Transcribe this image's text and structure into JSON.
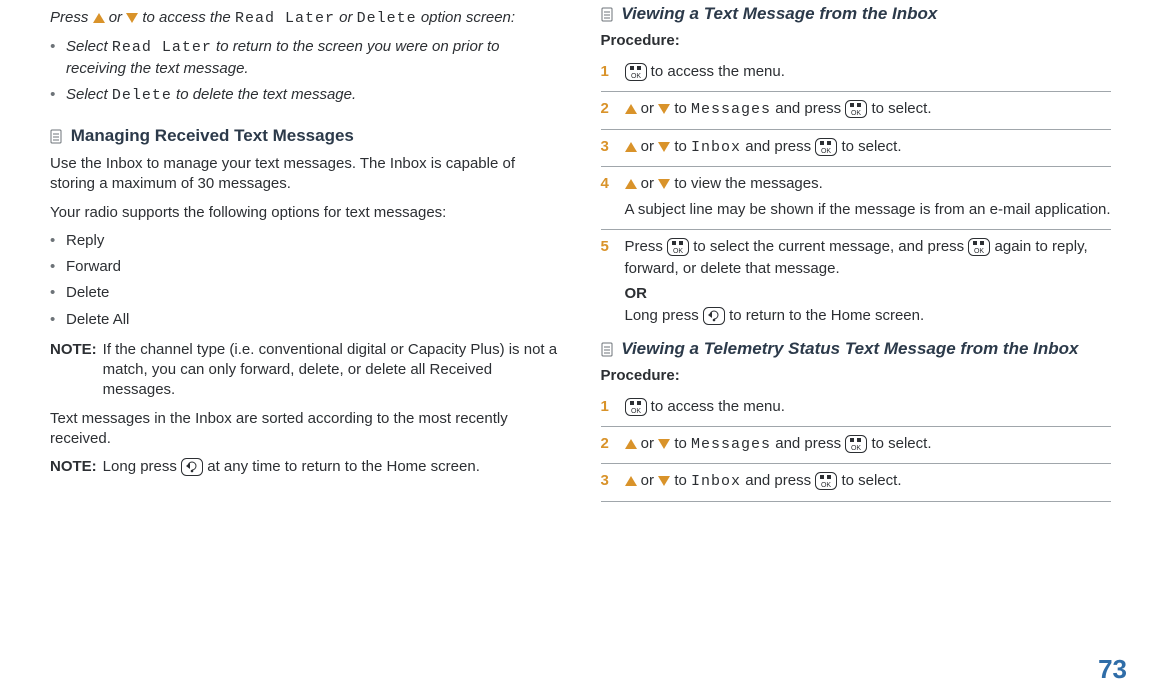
{
  "left": {
    "intro_pre": "Press ",
    "intro_mid": " or ",
    "intro_after_arrows": " to access the ",
    "intro_code1": "Read Later",
    "intro_between_codes": " or ",
    "intro_code2": "Delete",
    "intro_end": " option screen:",
    "bullet1_pre": "Select ",
    "bullet1_code": "Read Later",
    "bullet1_post": " to return to the screen you were on prior to receiving the text message.",
    "bullet2_pre": "Select ",
    "bullet2_code": "Delete",
    "bullet2_post": " to delete the text message.",
    "section_title": "Managing Received Text Messages",
    "para1": "Use the Inbox to manage your text messages. The Inbox is capable of storing a maximum of 30 messages.",
    "para2": "Your radio supports the following options for text messages:",
    "options": [
      "Reply",
      "Forward",
      "Delete",
      "Delete All"
    ],
    "note1_label": "NOTE:",
    "note1_body": "If the channel type (i.e. conventional digital or Capacity Plus) is not a match, you can only forward, delete, or delete all Received messages.",
    "para3": "Text messages in the Inbox are sorted according to the most recently received.",
    "note2_label": "NOTE:",
    "note2_pre": "Long press ",
    "note2_post": " at any time to return to the Home screen."
  },
  "right": {
    "sub1_title": "Viewing a Text Message from the Inbox",
    "procedure_label": "Procedure:",
    "step1_post": " to access the menu.",
    "step2_or": " or ",
    "step2_to": " to ",
    "step2_code": "Messages",
    "step2_press": " and press ",
    "step2_end": " to select.",
    "step3_code": "Inbox",
    "step4_post": " to view the messages.",
    "step4_second": "A subject line may be shown if the message is from an e-mail application.",
    "step5_pre": "Press ",
    "step5_mid": " to select the current message, and press ",
    "step5_end": " again to reply, forward, or delete that message.",
    "or_label": "OR",
    "step5_alt_pre": "Long press ",
    "step5_alt_post": " to return to the Home screen.",
    "sub2_title": "Viewing a Telemetry Status Text Message from the Inbox"
  },
  "page_number": "73"
}
